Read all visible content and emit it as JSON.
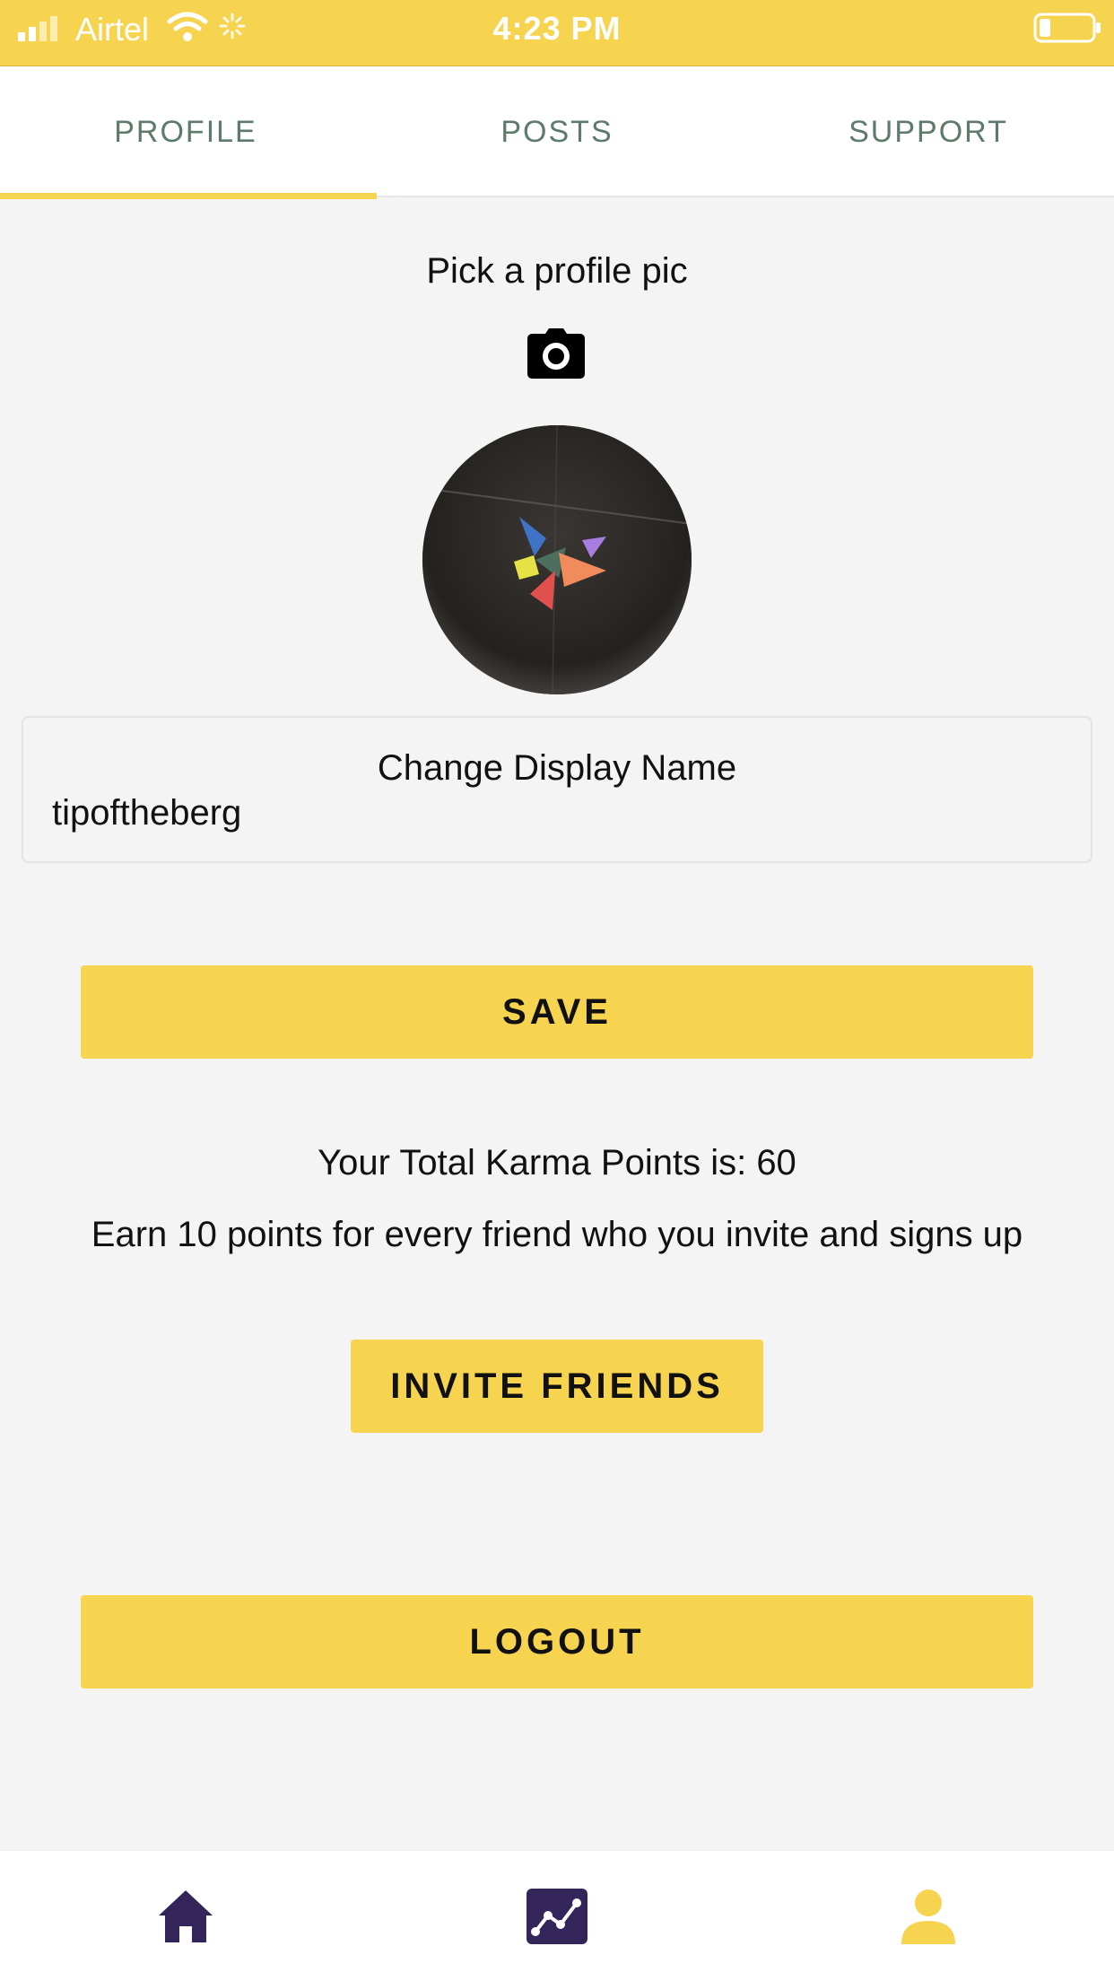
{
  "status_bar": {
    "carrier": "Airtel",
    "time": "4:23 PM",
    "icons": [
      "signal-icon",
      "wifi-icon",
      "activity-icon",
      "battery-icon"
    ]
  },
  "tabs": [
    {
      "label": "PROFILE",
      "active": true
    },
    {
      "label": "POSTS",
      "active": false
    },
    {
      "label": "SUPPORT",
      "active": false
    }
  ],
  "profile": {
    "pick_label": "Pick a profile pic",
    "camera_icon": "camera-icon",
    "display_name_label": "Change Display Name",
    "display_name_value": "tipoftheberg"
  },
  "buttons": {
    "save": "SAVE",
    "invite": "INVITE FRIENDS",
    "logout": "LOGOUT"
  },
  "karma": {
    "total_text": "Your Total Karma Points is: 60",
    "earn_text": "Earn 10 points for every friend who you invite and signs up"
  },
  "bottom_nav": [
    {
      "icon": "home-icon",
      "active": false
    },
    {
      "icon": "chart-icon",
      "active": false
    },
    {
      "icon": "profile-icon",
      "active": true
    }
  ],
  "colors": {
    "accent": "#f6d44f",
    "tab_text": "#5d7a6a",
    "nav_icon": "#33245a",
    "background": "#f4f4f4"
  }
}
